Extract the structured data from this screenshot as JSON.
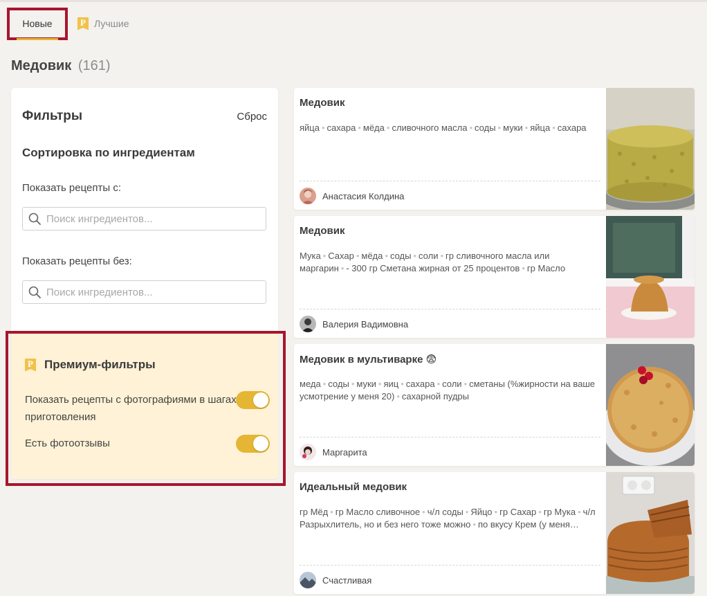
{
  "tabs": [
    {
      "label": "Новые",
      "active": true
    },
    {
      "label": "Лучшие",
      "active": false,
      "icon": "premium-bookmark-icon"
    }
  ],
  "page": {
    "title": "Медовик",
    "count": "(161)"
  },
  "filters": {
    "title": "Фильтры",
    "reset": "Сброс",
    "sort_title": "Сортировка по ингредиентам",
    "include_label": "Показать рецепты с:",
    "include_placeholder": "Поиск ингредиентов...",
    "exclude_label": "Показать рецепты без:",
    "exclude_placeholder": "Поиск ингредиентов..."
  },
  "premium": {
    "title": "Премиум-фильтры",
    "icon": "premium-bookmark-icon",
    "options": [
      {
        "label": "Показать рецепты с фотографиями в шагах приготовления",
        "on": true
      },
      {
        "label": "Есть фотоотзывы",
        "on": true
      }
    ]
  },
  "colors": {
    "accent": "#e5b534",
    "highlight": "#a8152e",
    "premium_bg": "#fff2d6"
  },
  "recipes": [
    {
      "title": "Медовик",
      "ingredients": [
        "яйца",
        "сахара",
        "мёда",
        "сливочного масла",
        "соды",
        "муки",
        "яйца",
        "сахара"
      ],
      "author": "Анастасия Колдина"
    },
    {
      "title": "Медовик",
      "ingredients": [
        "Мука",
        "Сахар",
        "мёда",
        "соды",
        "соли",
        "гр сливочного масла или маргарин",
        "- 300 гр Сметана жирная от 25 процентов",
        "гр Масло"
      ],
      "author": "Валерия Вадимовна"
    },
    {
      "title": "Медовик в мультиварке 😨",
      "ingredients": [
        "меда",
        "соды",
        "муки",
        "яиц",
        "сахара",
        "соли",
        "сметаны (%жирности на ваше усмотрение у меня 20)",
        "сахарной пудры"
      ],
      "author": "Маргарита"
    },
    {
      "title": "Идеальный медовик",
      "ingredients": [
        "гр Мёд",
        "гр Масло сливочное",
        "ч/л соды",
        "Яйцо",
        "гр Сахар",
        "гр Мука",
        "ч/л Разрыхлитель, но и без него тоже можно",
        "по вкусу Крем (у меня…"
      ],
      "author": "Счастливая"
    }
  ]
}
